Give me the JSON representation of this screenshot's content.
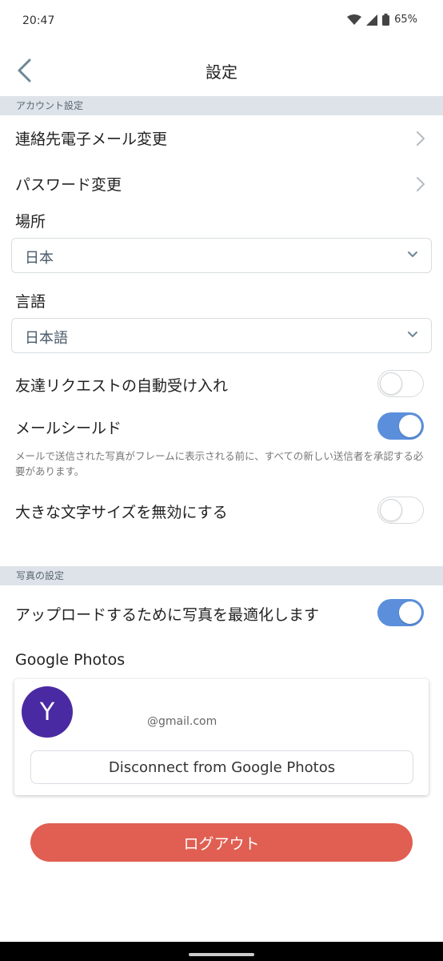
{
  "status_bar": {
    "time": "20:47",
    "battery": "65%"
  },
  "header": {
    "title": "設定"
  },
  "account_section": {
    "title": "アカウント設定",
    "change_email": "連絡先電子メール変更",
    "change_password": "パスワード変更",
    "location_label": "場所",
    "location_value": "日本",
    "language_label": "言語",
    "language_value": "日本語",
    "auto_accept_label": "友達リクエストの自動受け入れ",
    "auto_accept_on": false,
    "mail_shield_label": "メールシールド",
    "mail_shield_on": true,
    "mail_shield_help": "メールで送信された写真がフレームに表示される前に、すべての新しい送信者を承認する必要があります。",
    "disable_large_text_label": "大きな文字サイズを無効にする",
    "disable_large_text_on": false
  },
  "photo_section": {
    "title": "写真の設定",
    "optimize_label": "アップロードするために写真を最適化します",
    "optimize_on": true,
    "google_photos_label": "Google Photos",
    "avatar_letter": "Y",
    "account_email": "@gmail.com",
    "disconnect_label": "Disconnect from Google Photos"
  },
  "logout_label": "ログアウト",
  "colors": {
    "accent": "#5b8fdb",
    "logout": "#e05f52",
    "avatar": "#4a2aa3",
    "section_bg": "#dde3e8"
  }
}
